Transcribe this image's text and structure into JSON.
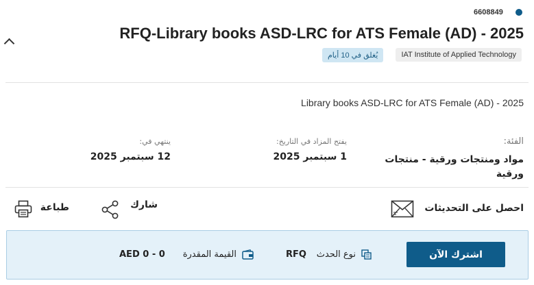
{
  "tender": {
    "id": "6608849",
    "title": "RFQ-Library books ASD-LRC for ATS Female (AD) - 2025",
    "org_tag": "IAT Institute of Applied Technology",
    "closing_tag": "يُغلق في 10 أيام",
    "description": "Library books ASD-LRC for ATS Female (AD) - 2025"
  },
  "meta": {
    "category_label": "الفئة:",
    "category_value": "مواد ومنتجات ورقية - منتجات ورقية",
    "opens_label": "يفتح المزاد في التاريخ:",
    "opens_value": "1 سبتمبر 2025",
    "ends_label": "ينتهي في:",
    "ends_value": "12 سبتمبر 2025"
  },
  "actions": {
    "updates_label": "احصل على التحديثات",
    "share_label": "شارك",
    "print_label": "طباعة"
  },
  "panel": {
    "subscribe_label": "اشترك الآن",
    "event_type_label": "نوع الحدث",
    "event_type_value": "RFQ",
    "estimated_label": "القيمة المقدرة",
    "estimated_value": "AED 0 - 0"
  },
  "colors": {
    "primary": "#0f5c8a",
    "panel_bg": "#e4f1f9",
    "tag_blue_bg": "#cfe6f3"
  }
}
